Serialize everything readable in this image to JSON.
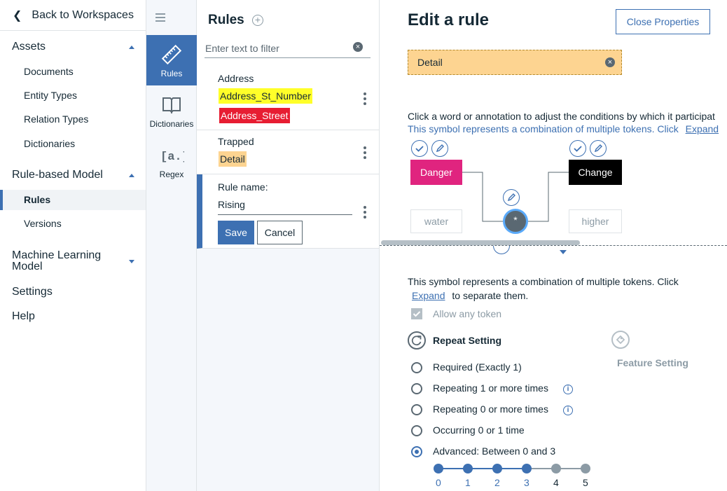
{
  "nav": {
    "back_label": "Back to Workspaces",
    "sections": [
      {
        "label": "Assets",
        "items": [
          "Documents",
          "Entity Types",
          "Relation Types",
          "Dictionaries"
        ]
      },
      {
        "label": "Rule-based Model",
        "items": [
          "Rules",
          "Versions"
        ]
      },
      {
        "label": "Machine Learning Model"
      },
      {
        "label": "Settings"
      },
      {
        "label": "Help"
      }
    ],
    "active_item": "Rules"
  },
  "rail": {
    "items": [
      {
        "label": "Rules",
        "icon": "ruler-icon",
        "active": true
      },
      {
        "label": "Dictionaries",
        "icon": "book-icon",
        "active": false
      },
      {
        "label": "Regex",
        "icon": "regex-icon",
        "active": false
      }
    ]
  },
  "rules_panel": {
    "title": "Rules",
    "filter_placeholder": "Enter text to filter",
    "rules": [
      {
        "name": "Address",
        "tags": [
          {
            "text": "Address_St_Number",
            "color": "#ffff29"
          },
          {
            "text": "Address_Street",
            "color": "#e71d32"
          }
        ]
      },
      {
        "name": "Trapped",
        "tags": [
          {
            "text": "Detail",
            "color": "#fdd491"
          }
        ]
      }
    ],
    "editor": {
      "label": "Rule name:",
      "value": "Rising",
      "save_label": "Save",
      "cancel_label": "Cancel"
    }
  },
  "main": {
    "title": "Edit a rule",
    "close_label": "Close Properties",
    "entity_label": "Detail",
    "instruction": "Click a word or annotation to adjust the conditions by which it participat",
    "symbol_note": "This symbol represents a combination of multiple tokens. Click",
    "expand_label": "Expand",
    "tokens": {
      "danger": {
        "label": "Danger",
        "color": "#e0247f"
      },
      "change": {
        "label": "Change",
        "color": "#000000"
      },
      "water": "water",
      "higher": "higher",
      "star": "*"
    },
    "detail": {
      "note_line1": "This symbol represents a combination of multiple tokens. Click",
      "expand_label": "Expand",
      "note_line2": "to separate them.",
      "allow_any_label": "Allow any token",
      "allow_any_checked": true,
      "repeat_title": "Repeat Setting",
      "feature_title": "Feature Setting",
      "options": [
        {
          "label": "Required (Exactly 1)",
          "selected": false,
          "info": false
        },
        {
          "label": "Repeating 1 or more times",
          "selected": false,
          "info": true
        },
        {
          "label": "Repeating 0 or more times",
          "selected": false,
          "info": true
        },
        {
          "label": "Occurring 0 or 1 time",
          "selected": false,
          "info": false
        },
        {
          "label": "Advanced: Between 0 and 3",
          "selected": true,
          "info": false
        }
      ],
      "slider": {
        "ticks": [
          "0",
          "1",
          "2",
          "3",
          "4",
          "5"
        ],
        "min_selected": 0,
        "max_selected": 3,
        "active_color": "#3d70b2",
        "inactive_color": "#8c9ba5"
      }
    }
  }
}
